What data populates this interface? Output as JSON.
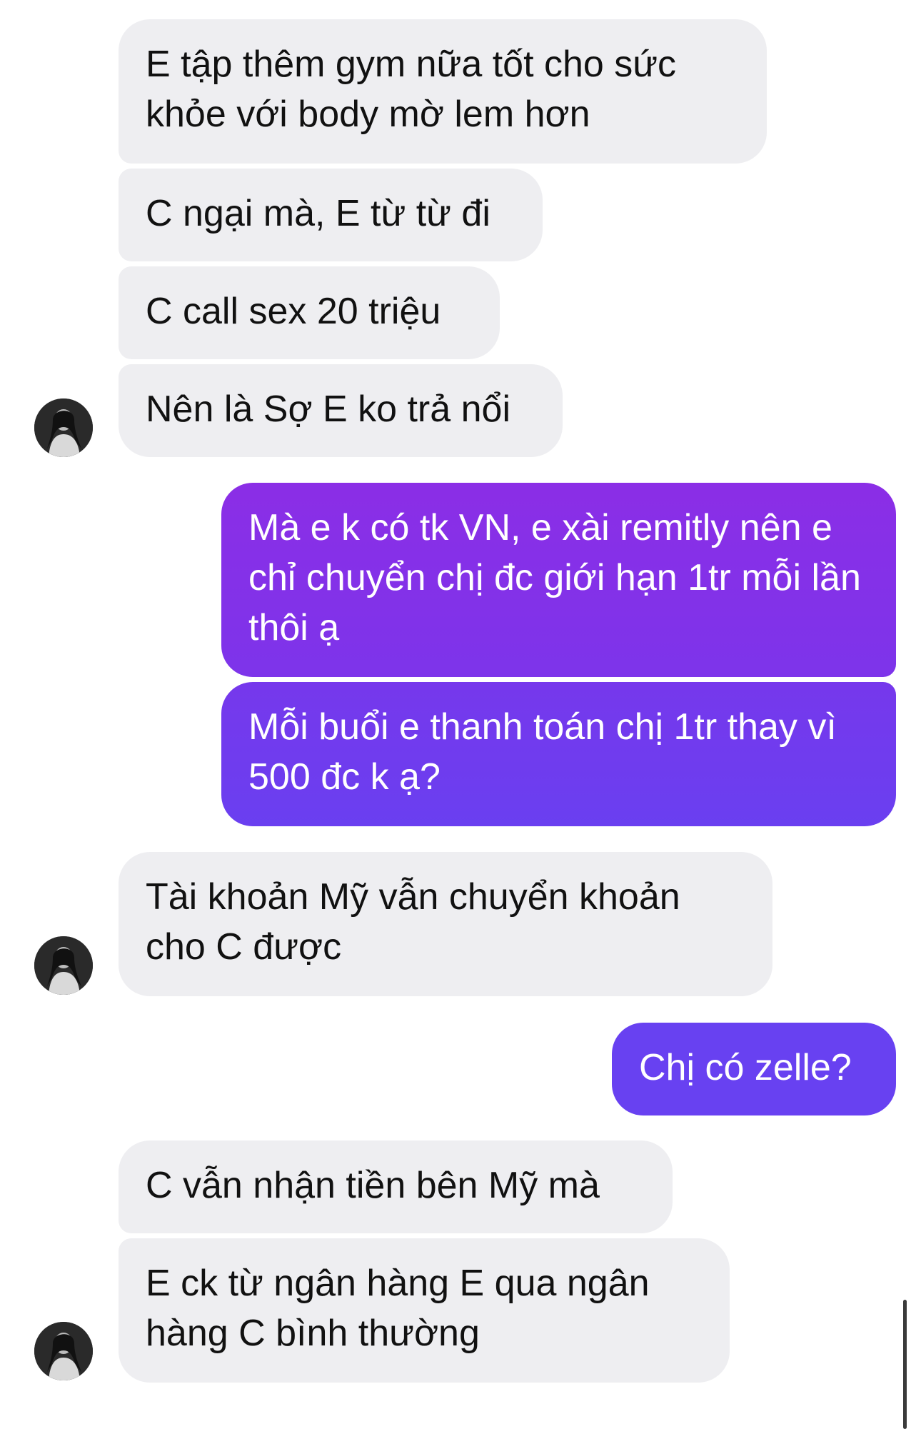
{
  "conversation": {
    "messages": [
      {
        "sender": "them",
        "text": "E tập thêm gym nữa tốt cho sức khỏe với body mờ lem hơn"
      },
      {
        "sender": "them",
        "text": "C ngại mà, E từ từ đi"
      },
      {
        "sender": "them",
        "text": "C call sex 20 triệu"
      },
      {
        "sender": "them",
        "text": "Nên là Sợ E ko trả nổi"
      },
      {
        "sender": "me",
        "text": "Mà e k có tk VN, e xài remitly nên e chỉ chuyển chị đc giới hạn 1tr mỗi lần thôi ạ"
      },
      {
        "sender": "me",
        "text": "Mỗi buổi e thanh toán chị 1tr thay vì 500 đc k ạ?"
      },
      {
        "sender": "them",
        "text": "Tài khoản Mỹ vẫn chuyển khoản cho C được"
      },
      {
        "sender": "me",
        "text": "Chị có zelle?"
      },
      {
        "sender": "them",
        "text": "C vẫn nhận tiền bên Mỹ mà"
      },
      {
        "sender": "them",
        "text": "E ck từ ngân hàng E qua ngân hàng C bình thường"
      }
    ]
  },
  "colors": {
    "incoming_bubble": "#eeeef1",
    "incoming_text": "#111111",
    "outgoing_text": "#ffffff",
    "outgoing_gradient_top": "#8a2fe6",
    "outgoing_gradient_bottom": "#6a3ff0"
  },
  "icons": {
    "avatar": "contact-avatar"
  }
}
